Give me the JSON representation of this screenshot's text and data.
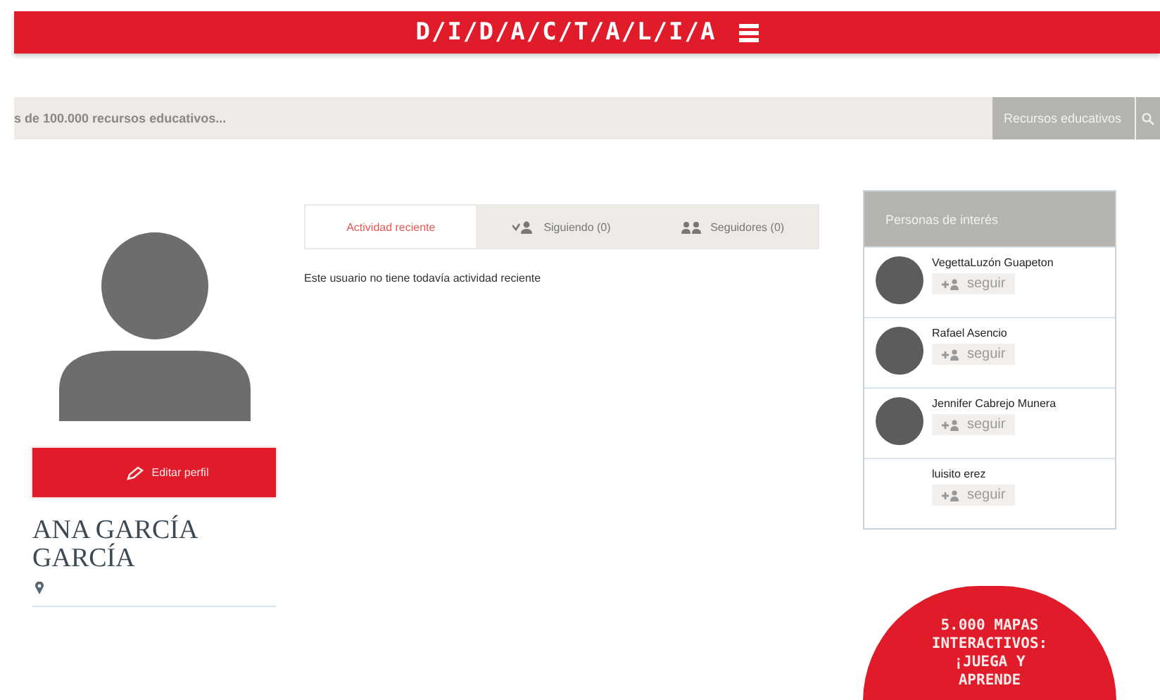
{
  "header": {
    "logo": "D/I/D/A/C/T/A/L/I/A"
  },
  "search": {
    "placeholder": "s de 100.000 recursos educativos...",
    "category": "Recursos educativos"
  },
  "profile": {
    "edit_button": "Editar perfil",
    "name": "ANA GARCÍA GARCÍA"
  },
  "tabs": [
    {
      "label": "Actividad reciente",
      "selected": true,
      "kind": "plain"
    },
    {
      "label": "Siguiendo (0)",
      "selected": false,
      "kind": "following"
    },
    {
      "label": "Seguidores (0)",
      "selected": false,
      "kind": "followers"
    }
  ],
  "activity_message": "Este usuario no tiene todavía actividad reciente",
  "people": {
    "title": "Personas de interés",
    "items": [
      {
        "name": "VegettaLuzón Guapeton",
        "has_photo": true,
        "follow_label": "seguir"
      },
      {
        "name": "Rafael Asencio",
        "has_photo": true,
        "follow_label": "seguir"
      },
      {
        "name": "Jennifer Cabrejo Munera",
        "has_photo": true,
        "follow_label": "seguir"
      },
      {
        "name": "luisito erez",
        "has_photo": false,
        "follow_label": "seguir"
      }
    ]
  },
  "promo": {
    "text": "5.000 MAPAS INTERACTIVOS: ¡JUEGA Y APRENDE"
  }
}
